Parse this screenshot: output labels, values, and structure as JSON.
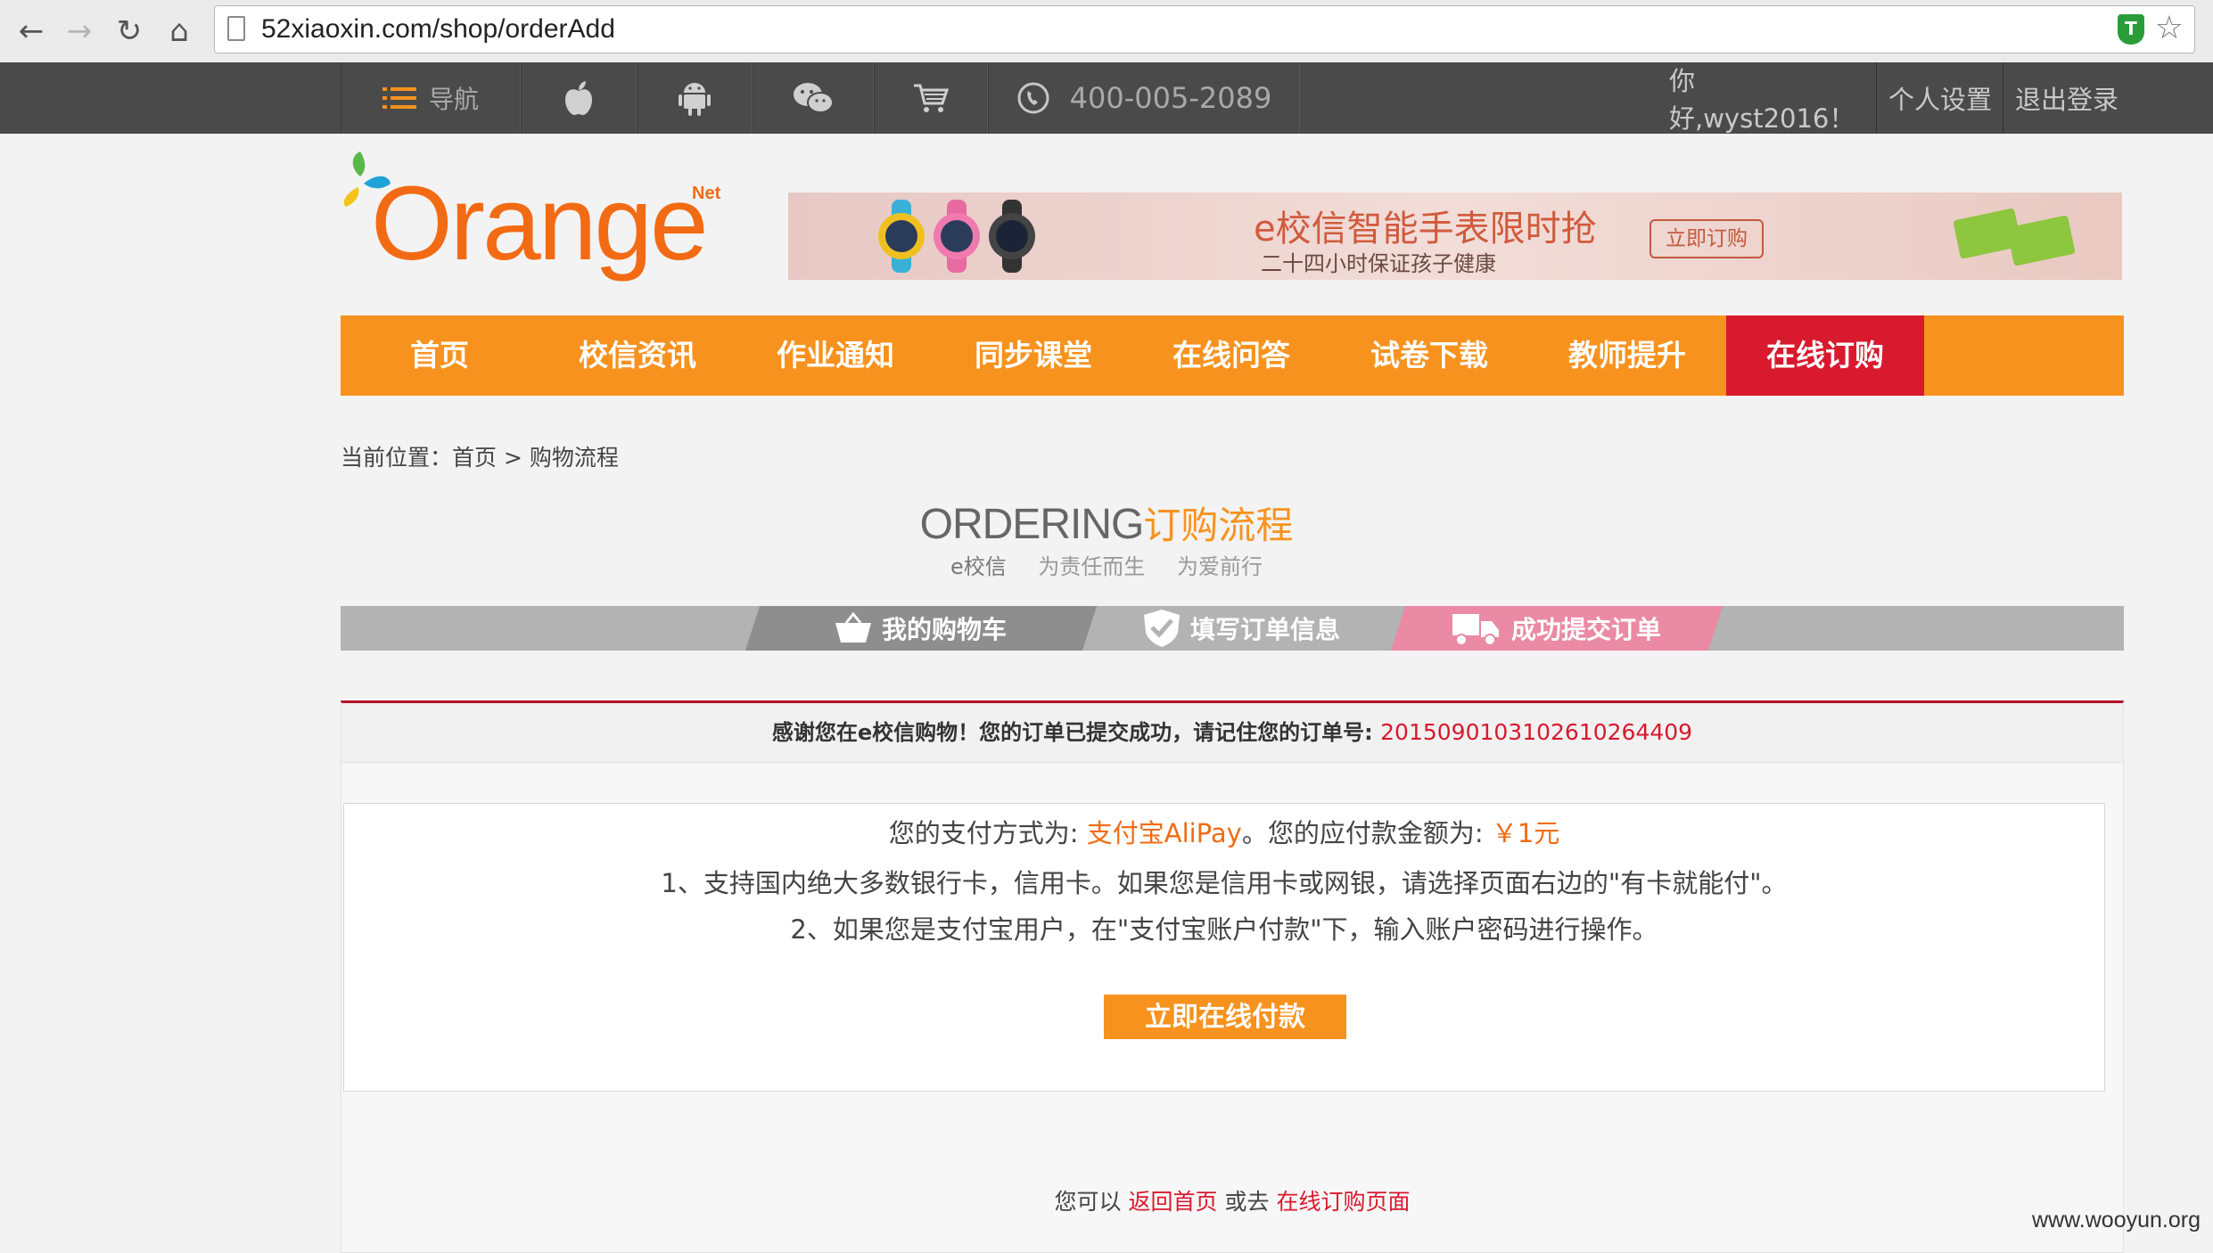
{
  "browser": {
    "url": "52xiaoxin.com/shop/orderAdd"
  },
  "topbar": {
    "nav_label": "导航",
    "phone": "400-005-2089",
    "greeting": "你好,wyst2016！",
    "settings": "个人设置",
    "logout": "退出登录",
    "icons": [
      "menu-icon",
      "apple-icon",
      "android-icon",
      "wechat-icon",
      "cart-icon",
      "phone-icon"
    ]
  },
  "logo": {
    "text": "Orange",
    "superscript": "Net"
  },
  "banner": {
    "title": "e校信智能手表限时抢",
    "subtitle": "二十四小时保证孩子健康",
    "button": "立即订购"
  },
  "mainnav": {
    "items": [
      {
        "label": "首页"
      },
      {
        "label": "校信资讯"
      },
      {
        "label": "作业通知"
      },
      {
        "label": "同步课堂"
      },
      {
        "label": "在线问答"
      },
      {
        "label": "试卷下载"
      },
      {
        "label": "教师提升"
      },
      {
        "label": "在线订购"
      }
    ],
    "active_color": "#d8192e",
    "bar_color": "#f7921e"
  },
  "breadcrumb": {
    "prefix": "当前位置：",
    "home": "首页",
    "sep": ">",
    "current": "购物流程"
  },
  "heading": {
    "en": "ORDERING",
    "cn": "订购流程",
    "brand": "e校信",
    "slogan1": "为责任而生",
    "slogan2": "为爱前行"
  },
  "steps": [
    {
      "label": "我的购物车",
      "icon": "basket-icon"
    },
    {
      "label": "填写订单信息",
      "icon": "check-shield-icon"
    },
    {
      "label": "成功提交订单",
      "icon": "truck-icon"
    }
  ],
  "order": {
    "thanks": "感谢您在e校信购物！您的订单已提交成功，请记住您的订单号:",
    "order_no": "2015090103102610264409",
    "pay_method_prefix": "您的支付方式为:",
    "pay_method": "支付宝AliPay",
    "amount_prefix": "。您的应付款金额为:",
    "amount": "￥1元",
    "note1": "1、支持国内绝大多数银行卡，信用卡。如果您是信用卡或网银，请选择页面右边的\"有卡就能付\"。",
    "note2": "2、如果您是支付宝用户，在\"支付宝账户付款\"下，输入账户密码进行操作。",
    "pay_button": "立即在线付款"
  },
  "footer": {
    "prefix": "您可以",
    "link1": "返回首页",
    "middle": "或去",
    "link2": "在线订购页面"
  },
  "watermark": "www.wooyun.org"
}
